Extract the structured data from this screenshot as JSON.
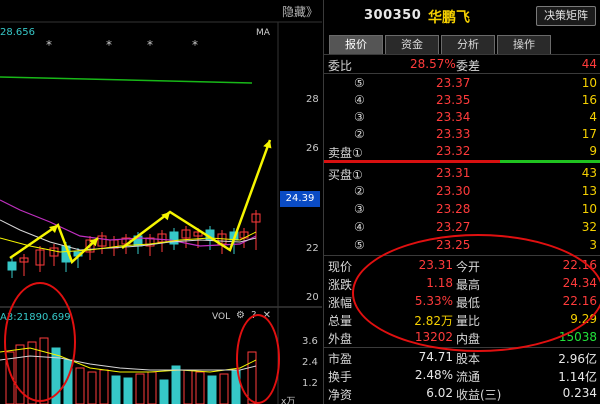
{
  "chart": {
    "hide_label": "隐藏》",
    "price_label": "28.656",
    "ma_label": "MA",
    "vol_label": "VOL",
    "vol_ma_label": "A3:21890.699",
    "current_price_tag": "24.39",
    "unit_label": "x万",
    "price_ticks": [
      "28",
      "26",
      "24",
      "22",
      "20"
    ],
    "vol_ticks": [
      "3.6",
      "2.4",
      "1.2"
    ],
    "stars": [
      "*",
      "*",
      "*",
      "*"
    ]
  },
  "header": {
    "code": "300350",
    "name": "华鹏飞",
    "decision_button": "决策矩阵"
  },
  "tabs": [
    {
      "label": "报价",
      "active": true
    },
    {
      "label": "资金",
      "active": false
    },
    {
      "label": "分析",
      "active": false
    },
    {
      "label": "操作",
      "active": false
    }
  ],
  "ratio": {
    "label": "委比",
    "value": "28.57%",
    "diff_label": "委差",
    "diff_value": "44"
  },
  "sell_levels": [
    {
      "label": "⑤",
      "price": "23.37",
      "volume": "10"
    },
    {
      "label": "④",
      "price": "23.35",
      "volume": "16"
    },
    {
      "label": "③",
      "price": "23.34",
      "volume": "4"
    },
    {
      "label": "②",
      "price": "23.33",
      "volume": "17"
    },
    {
      "label": "卖盘①",
      "price": "23.32",
      "volume": "9"
    }
  ],
  "buy_levels": [
    {
      "label": "买盘①",
      "price": "23.31",
      "volume": "43"
    },
    {
      "label": "②",
      "price": "23.30",
      "volume": "13"
    },
    {
      "label": "③",
      "price": "23.28",
      "volume": "10"
    },
    {
      "label": "④",
      "price": "23.27",
      "volume": "32"
    },
    {
      "label": "⑤",
      "price": "23.25",
      "volume": "3"
    }
  ],
  "stats": [
    {
      "l1": "现价",
      "v1": "23.31",
      "c1": "red",
      "l2": "今开",
      "v2": "22.16",
      "c2": "red"
    },
    {
      "l1": "涨跌",
      "v1": "1.18",
      "c1": "red",
      "l2": "最高",
      "v2": "24.34",
      "c2": "red"
    },
    {
      "l1": "涨幅",
      "v1": "5.33%",
      "c1": "red",
      "l2": "最低",
      "v2": "22.16",
      "c2": "red"
    },
    {
      "l1": "总量",
      "v1": "2.82万",
      "c1": "yellow",
      "l2": "量比",
      "v2": "9.29",
      "c2": "yellow"
    },
    {
      "l1": "外盘",
      "v1": "13202",
      "c1": "red",
      "l2": "内盘",
      "v2": "15038",
      "c2": "green"
    }
  ],
  "stats2": [
    {
      "l1": "市盈",
      "v1": "74.71",
      "l2": "股本",
      "v2": "2.96亿"
    },
    {
      "l1": "换手",
      "v1": "2.48%",
      "l2": "流通",
      "v2": "1.14亿"
    },
    {
      "l1": "净资",
      "v1": "6.02",
      "l2": "收益(三)",
      "v2": "0.234"
    }
  ],
  "colors": {
    "up": "#ff3b3b",
    "down": "#22e03a",
    "volume": "#f5d000",
    "cyan": "#36c7c7",
    "annotation": "#e01010",
    "arrow": "#f5f500"
  }
}
